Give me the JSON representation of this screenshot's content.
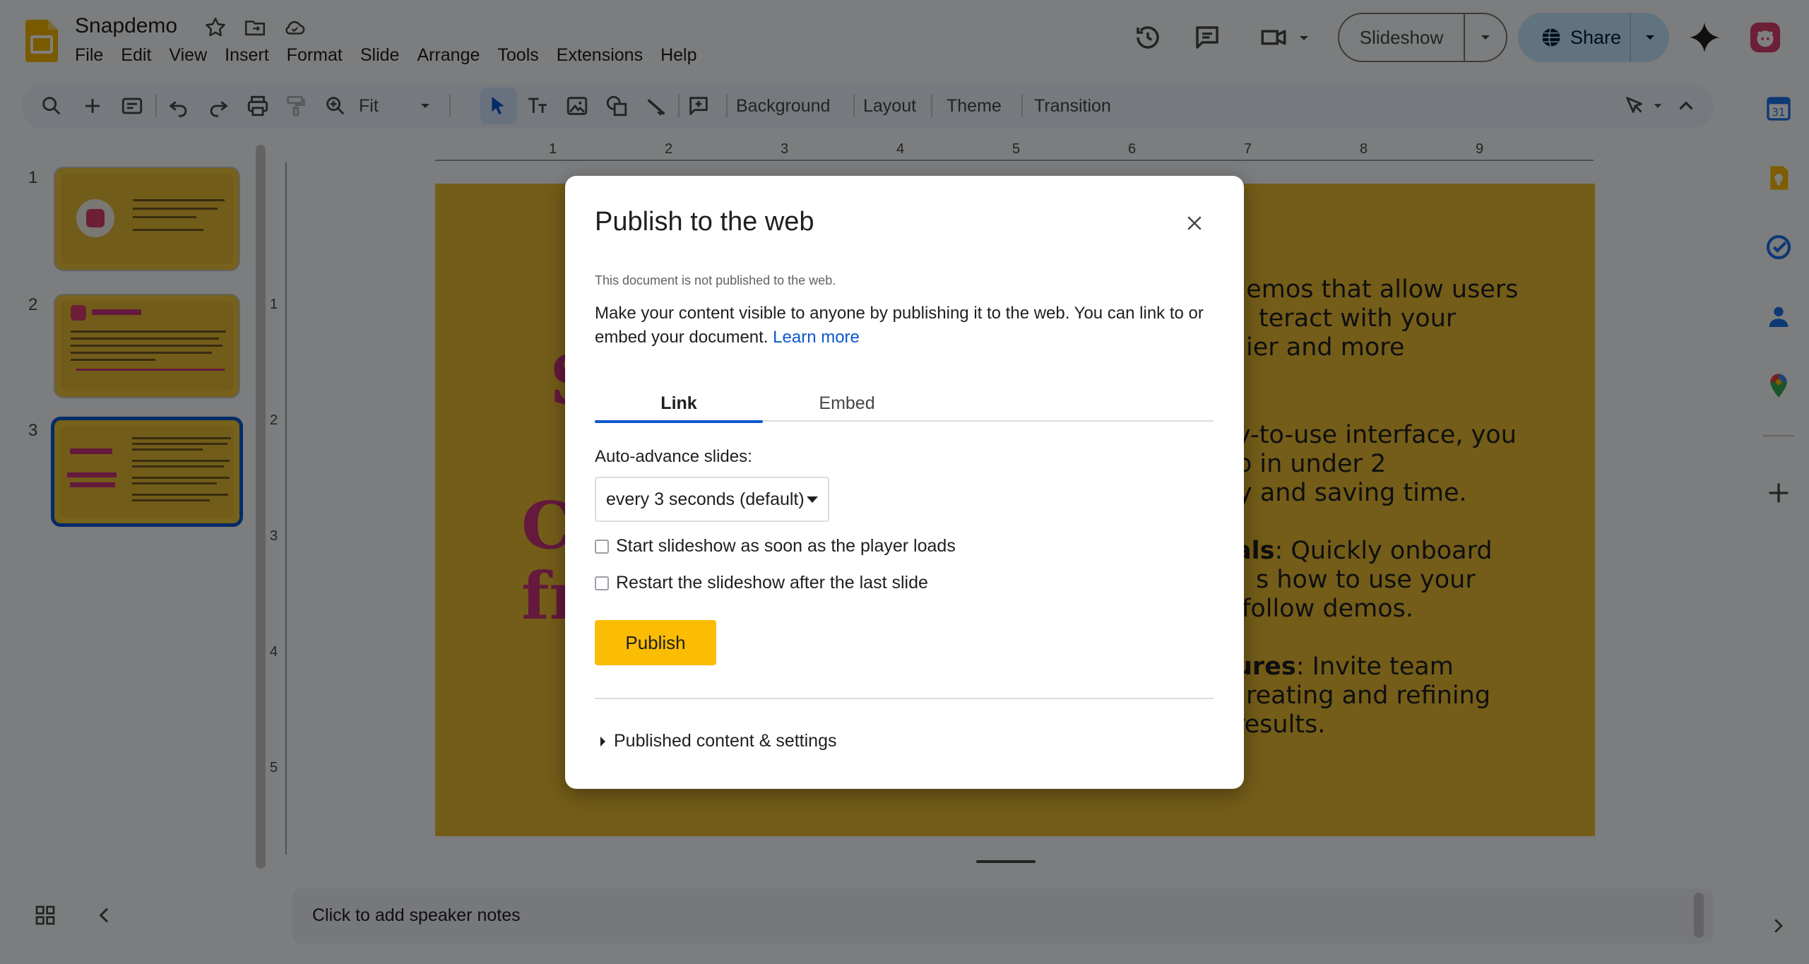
{
  "app": {
    "title": "Snapdemo",
    "menu": [
      "File",
      "Edit",
      "View",
      "Insert",
      "Format",
      "Slide",
      "Arrange",
      "Tools",
      "Extensions",
      "Help"
    ]
  },
  "header": {
    "slideshow_label": "Slideshow",
    "share_label": "Share"
  },
  "toolbar": {
    "zoom_value": "Fit",
    "background_label": "Background",
    "layout_label": "Layout",
    "theme_label": "Theme",
    "transition_label": "Transition"
  },
  "filmstrip": {
    "slides": [
      {
        "number": "1"
      },
      {
        "number": "2"
      },
      {
        "number": "3"
      }
    ]
  },
  "ruler": {
    "horizontal": [
      "1",
      "2",
      "3",
      "4",
      "5",
      "6",
      "7",
      "8",
      "9"
    ],
    "vertical": [
      "1",
      "2",
      "3",
      "4",
      "5"
    ]
  },
  "slide": {
    "lines": [
      "demos that allow users",
      "teract with your",
      "ier and more",
      "y-to-use interface, you",
      "p in under 2",
      "y and saving time.",
      "als",
      ": Quickly onboard",
      "s how to use your",
      "follow demos.",
      "ures",
      ": Invite team",
      "reating and refining",
      " results."
    ],
    "big_left": [
      "S",
      "C",
      "fr"
    ]
  },
  "notes": {
    "placeholder": "Click to add speaker notes"
  },
  "dialog": {
    "title": "Publish to the web",
    "status": "This document is not published to the web.",
    "description": "Make your content visible to anyone by publishing it to the web. You can link to or embed your document.",
    "learn_more": "Learn more",
    "tabs": [
      "Link",
      "Embed"
    ],
    "auto_advance_label": "Auto-advance slides:",
    "auto_advance_value": "every 3 seconds (default)",
    "checkbox_start": "Start slideshow as soon as the player loads",
    "checkbox_restart": "Restart the slideshow after the last slide",
    "publish_label": "Publish",
    "published_settings": "Published content & settings"
  },
  "colors": {
    "accent": "#0b57d0",
    "publish": "#fbbc04",
    "slide_bg": "#e9bb33",
    "slide_title": "#c9337a"
  }
}
